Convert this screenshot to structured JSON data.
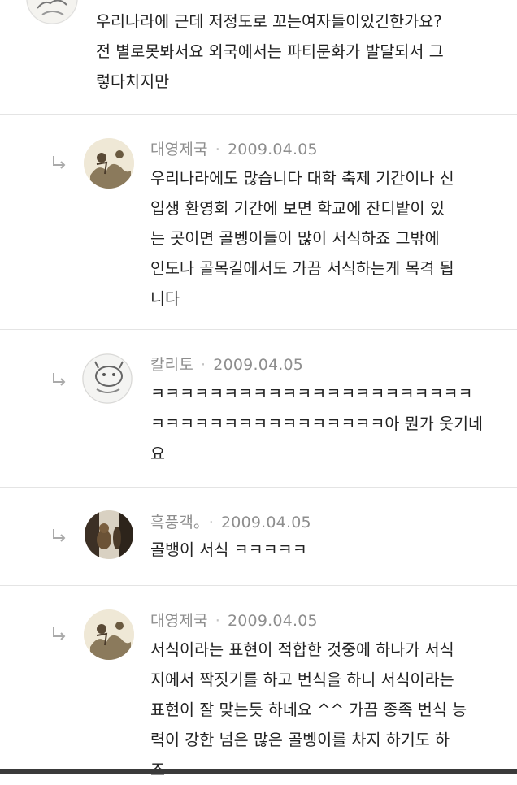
{
  "thread": {
    "top_comment": {
      "lines": [
        "우리나라에 근데 저정도로 꼬는여자들이있긴한가요?",
        "전 별로못봐서요 외국에서는 파티문화가 발달되서 그",
        "렇다치지만"
      ]
    },
    "replies": [
      {
        "author": "대영제국",
        "date": "2009.04.05",
        "avatar_icon": "painting-avatar-icon",
        "lines": [
          "우리나라에도 많습니다 대학 축제 기간이나 신",
          "입생 환영회 기간에 보면 학교에 잔디밭이 있",
          "는 곳이면 골벵이들이 많이 서식하죠 그밖에",
          "인도나 골목길에서도 가끔 서식하는게 목격 됩",
          "니다"
        ]
      },
      {
        "author": "칼리토",
        "date": "2009.04.05",
        "avatar_icon": "sketch-animal-avatar-icon",
        "lines": [
          "ㅋㅋㅋㅋㅋㅋㅋㅋㅋㅋㅋㅋㅋㅋㅋㅋㅋㅋㅋㅋㅋㅋ",
          "ㅋㅋㅋㅋㅋㅋㅋㅋㅋㅋㅋㅋㅋㅋㅋㅋ아 뭔가 웃기네",
          "요"
        ]
      },
      {
        "author": "흑풍객。",
        "date": "2009.04.05",
        "avatar_icon": "photo-avatar-icon",
        "lines": [
          "골뱅이 서식 ㅋㅋㅋㅋㅋ"
        ]
      },
      {
        "author": "대영제국",
        "date": "2009.04.05",
        "avatar_icon": "painting-avatar-icon",
        "lines": [
          "서식이라는 표현이 적합한 것중에 하나가 서식",
          "지에서 짝짓기를 하고 번식을 하니 서식이라는",
          "표현이 잘 맞는듯 하네요 ^^ 가끔 종족 번식 능",
          "력이 강한 넘은 많은 골벵이를 차지 하기도 하",
          "죠"
        ]
      }
    ],
    "separator": "·",
    "colors": {
      "meta": "#8e8e8e",
      "divider": "#e4e4e4",
      "text": "#222222"
    }
  }
}
